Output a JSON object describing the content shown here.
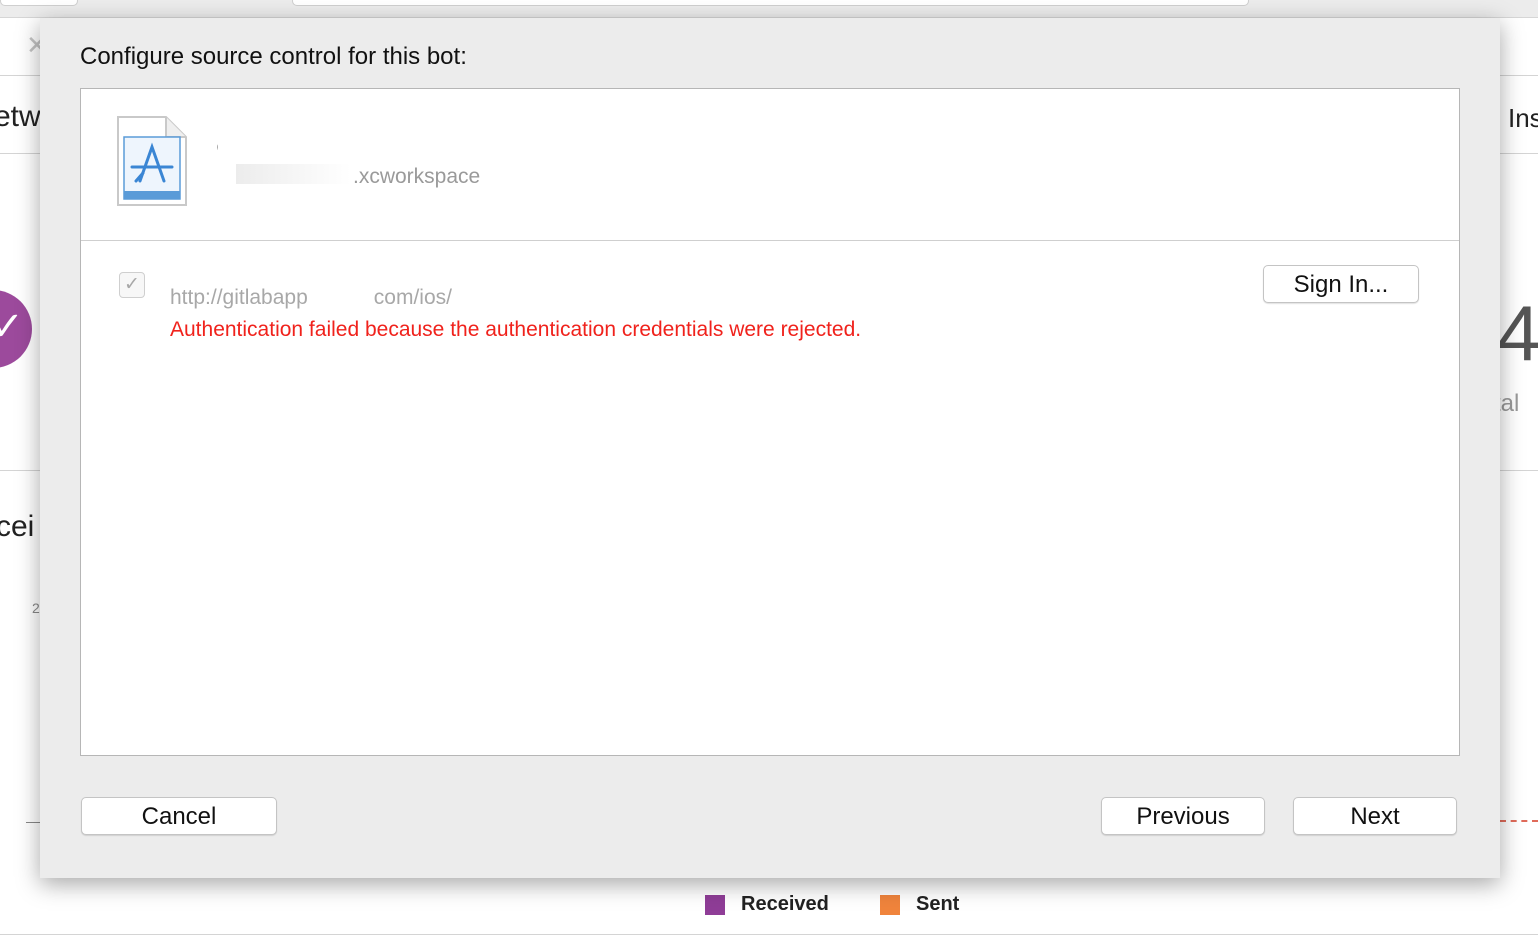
{
  "background": {
    "left_fragment": "etw",
    "right_fragment": "Ins",
    "lower_left_fragment": "cei",
    "big_number_fragment": "4",
    "total_fragment": "tal",
    "axis_tick_fragment": "2",
    "badge_colors": {
      "received": "#8f3d97",
      "sent": "#f0843c"
    },
    "legend": [
      {
        "label": "Received",
        "color": "#8f3d97"
      },
      {
        "label": "Sent",
        "color": "#f0843c"
      }
    ]
  },
  "dialog": {
    "title": "Configure source control for this bot:",
    "workspace": {
      "icon": "xcode-workspace-file-icon",
      "name_redacted": "C",
      "path_suffix": ".xcworkspace"
    },
    "repository": {
      "checked": true,
      "url_part1": "http://gitlabapp",
      "url_part2": "com/ios/",
      "error": "Authentication failed because the authentication credentials were rejected.",
      "error_color": "#f0221c"
    },
    "buttons": {
      "sign_in": "Sign In...",
      "cancel": "Cancel",
      "previous": "Previous",
      "next": "Next"
    }
  }
}
